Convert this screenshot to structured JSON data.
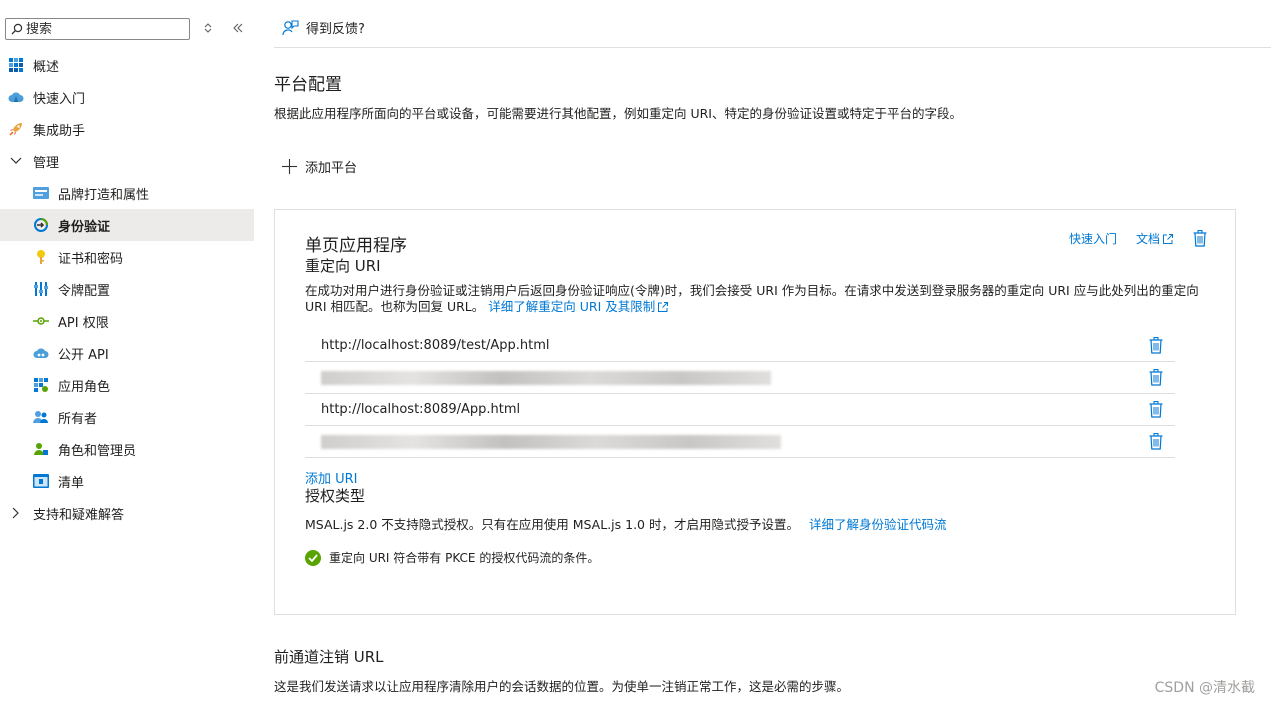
{
  "sidebar": {
    "search_placeholder": "搜索",
    "collapse_icon": "double-chevron-left-icon",
    "sort_icon": "sort-icon",
    "items": [
      {
        "label": "概述",
        "icon": "overview-icon"
      },
      {
        "label": "快速入门",
        "icon": "cloud-icon"
      },
      {
        "label": "集成助手",
        "icon": "rocket-icon"
      },
      {
        "label": "管理",
        "icon": "chevron-down-icon"
      },
      {
        "label": "品牌打造和属性",
        "icon": "branding-icon"
      },
      {
        "label": "身份验证",
        "icon": "authentication-icon"
      },
      {
        "label": "证书和密码",
        "icon": "key-icon"
      },
      {
        "label": "令牌配置",
        "icon": "token-icon"
      },
      {
        "label": "API 权限",
        "icon": "api-permissions-icon"
      },
      {
        "label": "公开 API",
        "icon": "cloud-api-icon"
      },
      {
        "label": "应用角色",
        "icon": "app-roles-icon"
      },
      {
        "label": "所有者",
        "icon": "owners-icon"
      },
      {
        "label": "角色和管理员",
        "icon": "roles-admins-icon"
      },
      {
        "label": "清单",
        "icon": "manifest-icon"
      },
      {
        "label": "支持和疑难解答",
        "icon": "chevron-right-icon"
      }
    ]
  },
  "header": {
    "feedback_label": "得到反馈?"
  },
  "platform": {
    "title": "平台配置",
    "description": "根据此应用程序所面向的平台或设备，可能需要进行其他配置，例如重定向 URI、特定的身份验证设置或特定于平台的字段。",
    "add_label": "添加平台"
  },
  "spa_card": {
    "title": "单页应用程序",
    "quickstart_link": "快速入门",
    "docs_link": "文档",
    "redirect_heading": "重定向 URI",
    "redirect_description": "在成功对用户进行身份验证或注销用户后返回身份验证响应(令牌)时，我们会接受 URI 作为目标。在请求中发送到登录服务器的重定向 URI 应与此处列出的重定向 URI 相匹配。也称为回复 URL。",
    "redirect_learn_more": "详细了解重定向 URI 及其限制",
    "uris": [
      {
        "value": "http://localhost:8089/test/App.html",
        "blurred": false
      },
      {
        "value": "",
        "blurred": true
      },
      {
        "value": "http://localhost:8089/App.html",
        "blurred": false
      },
      {
        "value": "",
        "blurred": true
      }
    ],
    "add_uri_label": "添加 URI",
    "grant_heading": "授权类型",
    "grant_description": "MSAL.js 2.0 不支持隐式授权。只有在应用使用 MSAL.js 1.0 时，才启用隐式授予设置。",
    "grant_learn_more": "详细了解身份验证代码流",
    "pkce_status": "重定向 URI 符合带有 PKCE 的授权代码流的条件。"
  },
  "front_channel": {
    "heading": "前通道注销 URL",
    "description": "这是我们发送请求以让应用程序清除用户的会话数据的位置。为使单一注销正常工作，这是必需的步骤。"
  },
  "watermark": "CSDN @清水截",
  "colors": {
    "accent": "#0078d4",
    "success": "#57a300",
    "active_bg": "#edebe9"
  }
}
